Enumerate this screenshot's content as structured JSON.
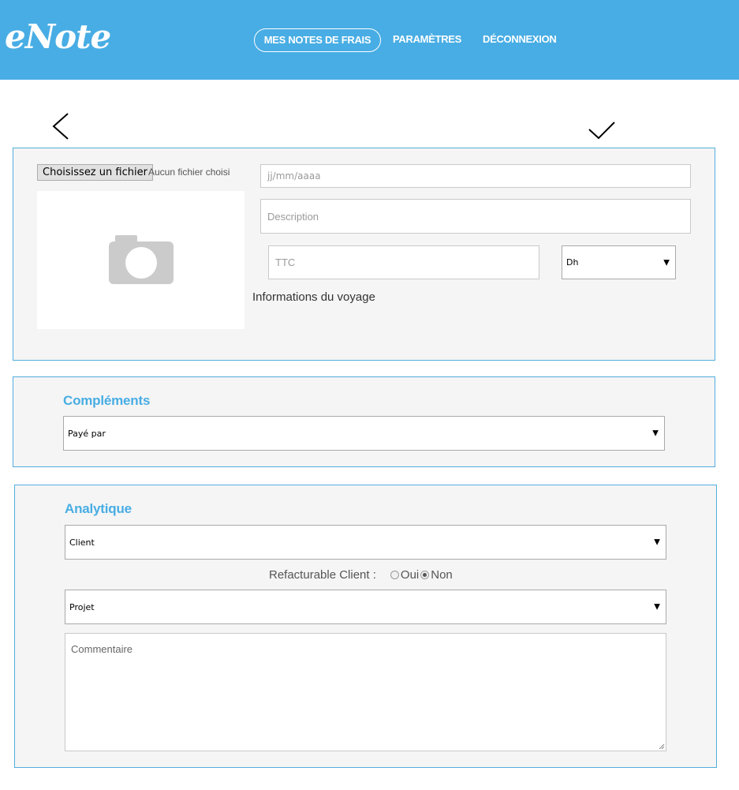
{
  "header": {
    "logo": "eNote",
    "nav": {
      "expenses": "MES NOTES DE FRAIS",
      "settings": "PARAMÈTRES",
      "logout": "DÉCONNEXION"
    }
  },
  "toolbar": {
    "back_icon": "chevron-left-icon",
    "save_icon": "checkmark-icon"
  },
  "receipt": {
    "file_button": "Choisissez un fichier",
    "file_status": "Aucun fichier choisi",
    "photo_icon": "camera-icon",
    "date_placeholder": "jj/mm/aaaa",
    "description_placeholder": "Description",
    "ttc_placeholder": "TTC",
    "currency_value": "Dh",
    "travel_info_label": "Informations du voyage"
  },
  "complements": {
    "title": "Compléments",
    "paid_by_value": "Payé par"
  },
  "analytique": {
    "title": "Analytique",
    "client_value": "Client",
    "refacturable_label": "Refacturable Client :",
    "option_yes": "Oui",
    "option_no": "Non",
    "selected": "Non",
    "project_value": "Projet",
    "comment_placeholder": "Commentaire"
  },
  "colors": {
    "brand": "#48ade4",
    "panel_border": "#52aedd",
    "panel_bg": "#f5f5f5"
  }
}
